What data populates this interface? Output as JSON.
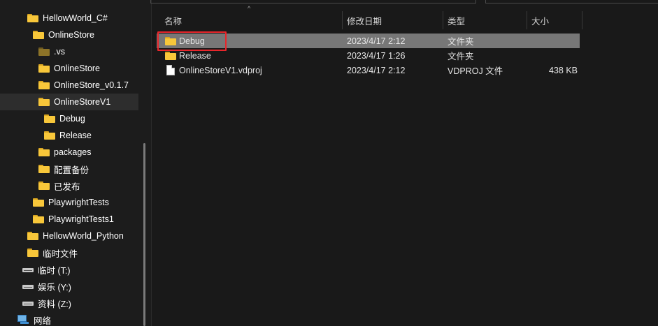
{
  "nav": {
    "items": [
      {
        "label": "HellowWorld_C#",
        "icon": "folder-icon",
        "level": 1
      },
      {
        "label": "OnlineStore",
        "icon": "folder-icon",
        "level": 2
      },
      {
        "label": ".vs",
        "icon": "folder-icon-hidden",
        "level": 3
      },
      {
        "label": "OnlineStore",
        "icon": "folder-icon",
        "level": 3
      },
      {
        "label": "OnlineStore_v0.1.7",
        "icon": "folder-icon",
        "level": 3
      },
      {
        "label": "OnlineStoreV1",
        "icon": "folder-icon",
        "level": 3,
        "selected": true
      },
      {
        "label": "Debug",
        "icon": "folder-icon",
        "level": 4
      },
      {
        "label": "Release",
        "icon": "folder-icon",
        "level": 4
      },
      {
        "label": "packages",
        "icon": "folder-icon",
        "level": 3
      },
      {
        "label": "配置备份",
        "icon": "folder-icon",
        "level": 3
      },
      {
        "label": "已发布",
        "icon": "folder-icon",
        "level": 3
      },
      {
        "label": "PlaywrightTests",
        "icon": "folder-icon",
        "level": 2
      },
      {
        "label": "PlaywrightTests1",
        "icon": "folder-icon",
        "level": 2
      },
      {
        "label": "HellowWorld_Python",
        "icon": "folder-icon",
        "level": 1
      },
      {
        "label": "临时文件",
        "icon": "folder-icon",
        "level": 1
      },
      {
        "label": "临时 (T:)",
        "icon": "drive-icon",
        "level": 1
      },
      {
        "label": "娱乐 (Y:)",
        "icon": "drive-icon",
        "level": 1
      },
      {
        "label": "资料 (Z:)",
        "icon": "drive-icon",
        "level": 1
      },
      {
        "label": "网络",
        "icon": "network-icon",
        "level": 0
      }
    ]
  },
  "columns": {
    "name": "名称",
    "modified": "修改日期",
    "type": "类型",
    "size": "大小"
  },
  "files": [
    {
      "name": "Debug",
      "modified": "2023/4/17 2:12",
      "type": "文件夹",
      "size": "",
      "icon": "folder-icon",
      "selected": true
    },
    {
      "name": "Release",
      "modified": "2023/4/17 1:26",
      "type": "文件夹",
      "size": "",
      "icon": "folder-icon"
    },
    {
      "name": "OnlineStoreV1.vdproj",
      "modified": "2023/4/17 2:12",
      "type": "VDPROJ 文件",
      "size": "438 KB",
      "icon": "file-icon"
    }
  ],
  "colors": {
    "background": "#191919",
    "selected_row": "#777777",
    "highlight_box": "#e8262b",
    "folder": "#f8c73a"
  }
}
